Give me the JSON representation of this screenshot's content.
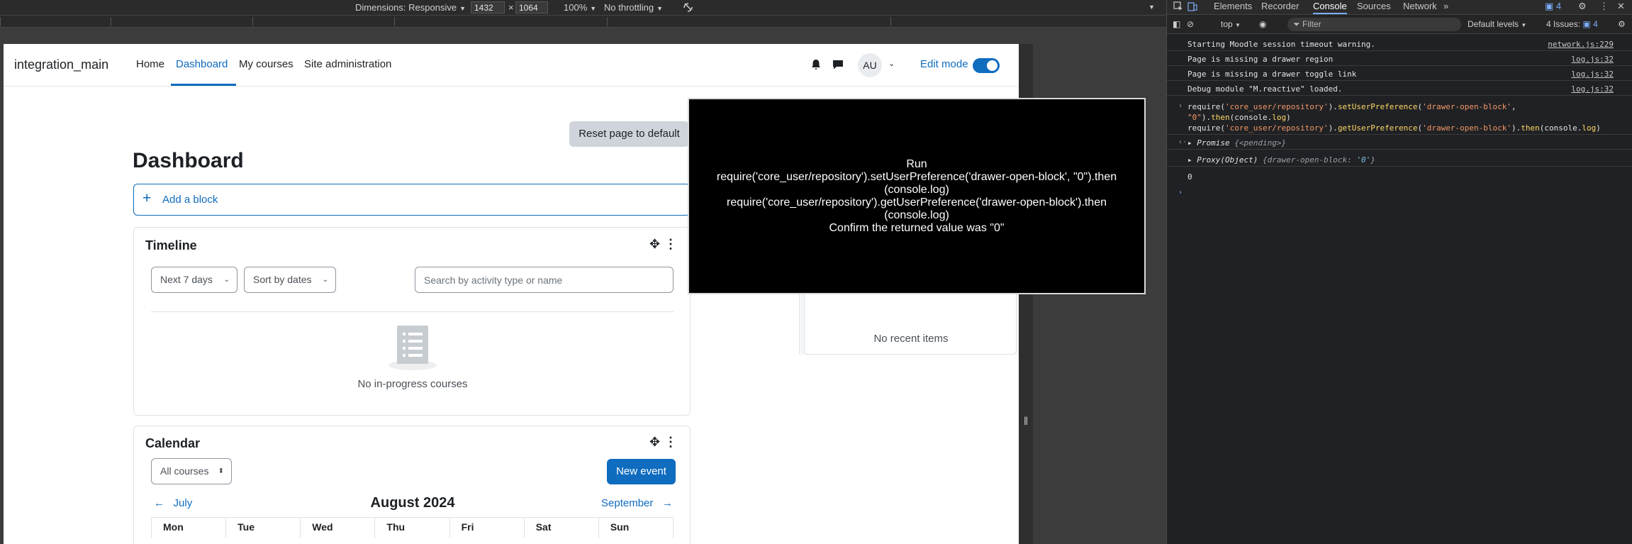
{
  "device_toolbar": {
    "dimensions_label": "Dimensions: Responsive",
    "width": "1432",
    "times": "×",
    "height": "1064",
    "zoom": "100%",
    "throttling": "No throttling"
  },
  "navbar": {
    "brand": "integration_main",
    "links": [
      "Home",
      "Dashboard",
      "My courses",
      "Site administration"
    ],
    "avatar": "AU",
    "edit_mode_label": "Edit mode"
  },
  "page": {
    "reset_label": "Reset page to default",
    "title": "Dashboard",
    "add_block_label": "Add a block"
  },
  "timeline": {
    "title": "Timeline",
    "filter_days": "Next 7 days",
    "sort": "Sort by dates",
    "search_placeholder": "Search by activity type or name",
    "empty_text": "No in-progress courses"
  },
  "calendar": {
    "title": "Calendar",
    "course_select": "All courses",
    "new_event_label": "New event",
    "prev_month": "July",
    "month": "August 2024",
    "next_month": "September",
    "days": [
      "Mon",
      "Tue",
      "Wed",
      "Thu",
      "Fri",
      "Sat",
      "Sun"
    ]
  },
  "recent": {
    "empty_text": "No recent items"
  },
  "overlay": {
    "text": "Run\nrequire('core_user/repository').setUserPreference('drawer-open-block', \"0\").then\n(console.log)\nrequire('core_user/repository').getUserPreference('drawer-open-block').then\n(console.log)\nConfirm the returned value was \"0\""
  },
  "devtools": {
    "tabs": [
      "Elements",
      "Recorder",
      "Console",
      "Sources",
      "Network"
    ],
    "active_tab": "Console",
    "issues_badge": "4",
    "toolbar": {
      "context": "top",
      "filter_placeholder": "Filter",
      "levels": "Default levels",
      "issues": "4 Issues:",
      "issues_count": "4"
    },
    "logs": [
      {
        "message": "Starting Moodle session timeout warning.",
        "source": "network.js:229"
      },
      {
        "message": "Page is missing a drawer region",
        "source": "log.js:32"
      },
      {
        "message": "Page is missing a drawer toggle link",
        "source": "log.js:32"
      },
      {
        "message": "Debug module \"M.reactive\" loaded.",
        "source": "log.js:32"
      }
    ],
    "command": {
      "line1_a": "require(",
      "line1_b": "'core_user/repository'",
      "line1_c": ").",
      "line1_d": "setUserPreference",
      "line1_e": "(",
      "line1_f": "'drawer-open-block'",
      "line1_g": ",",
      "line2_a": "\"0\"",
      "line2_b": ").",
      "line2_c": "then",
      "line2_d": "(console.",
      "line2_e": "log",
      "line2_f": ")",
      "line3_a": "require(",
      "line3_b": "'core_user/repository'",
      "line3_c": ").",
      "line3_d": "getUserPreference",
      "line3_e": "(",
      "line3_f": "'drawer-open-block'",
      "line3_g": ").",
      "line3_h": "then",
      "line3_i": "(console.",
      "line3_j": "log",
      "line3_k": ")"
    },
    "promise_label": "Promise",
    "promise_state": "{<pending>}",
    "proxy_label": "Proxy(Object)",
    "proxy_open": "{",
    "proxy_key": "drawer-open-block:",
    "proxy_value": "'0'",
    "proxy_close": "}",
    "result_value": "0"
  }
}
